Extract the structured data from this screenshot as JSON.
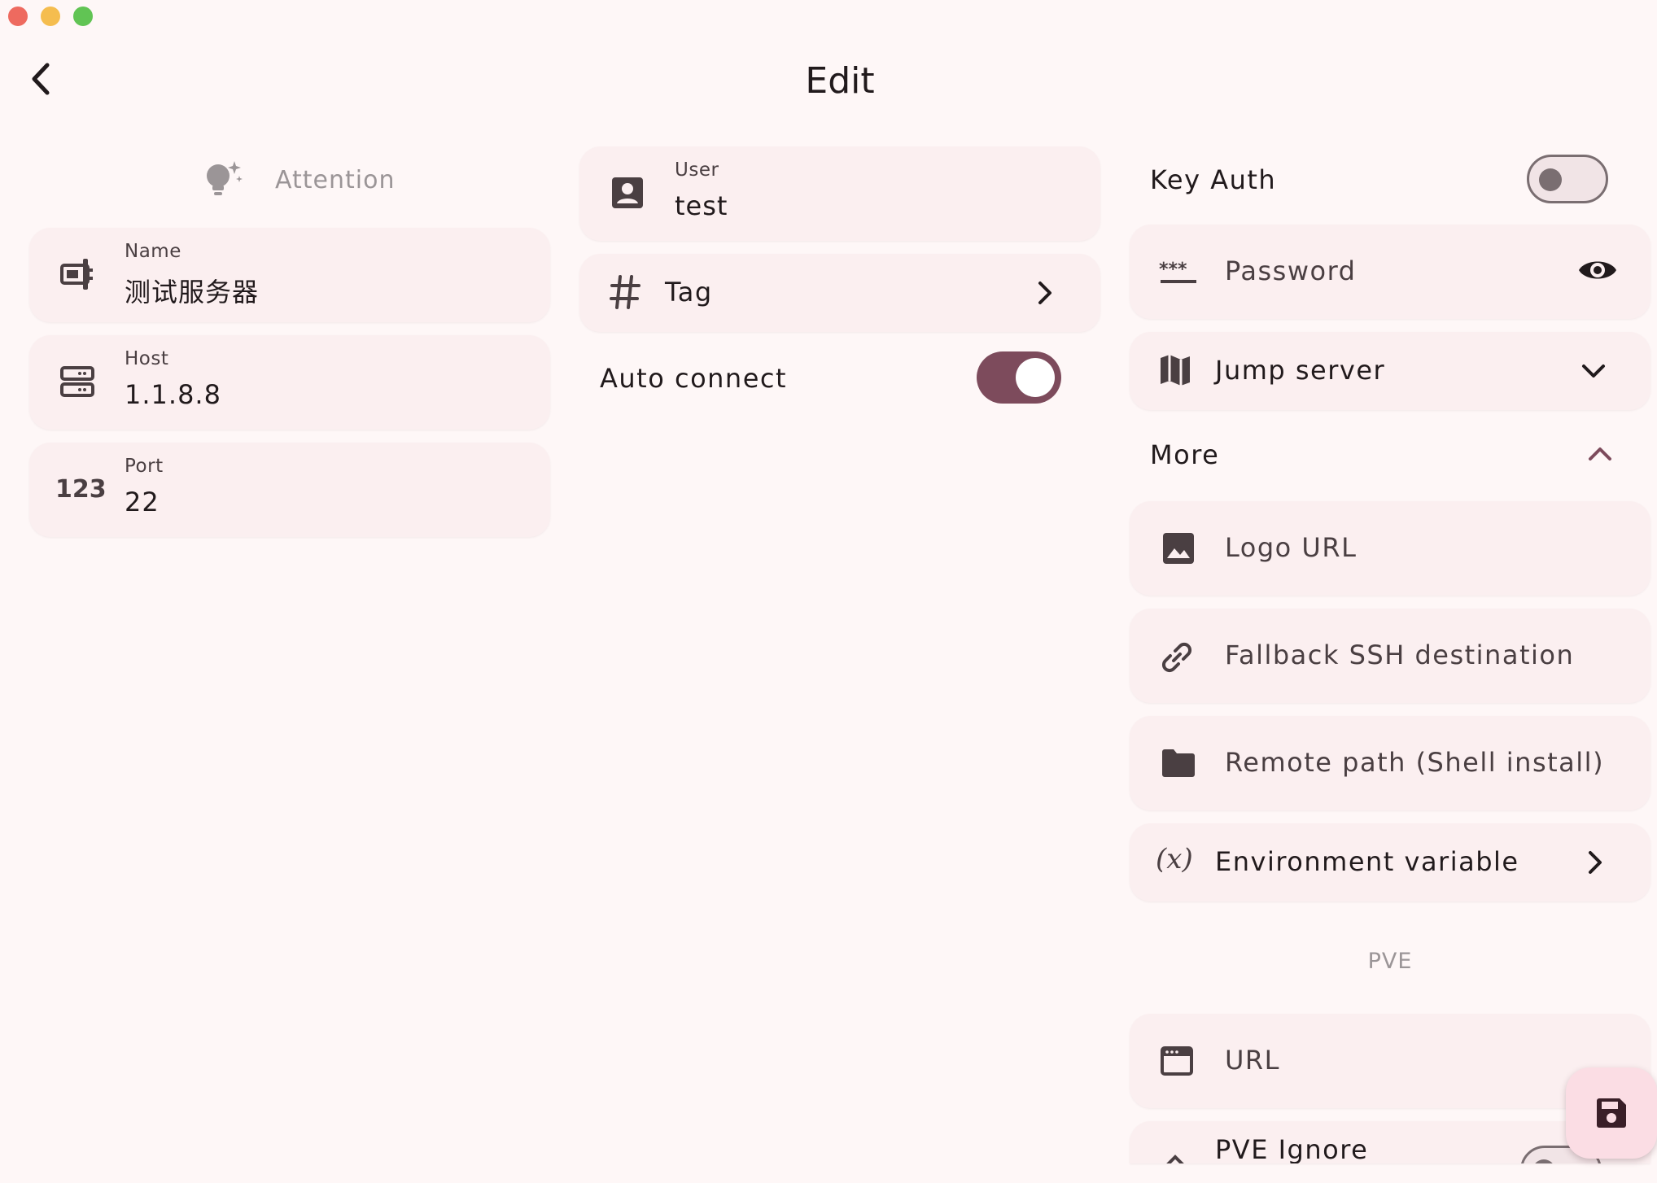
{
  "window": {
    "close_color": "#ee6a5f",
    "minimize_color": "#f5bd4f",
    "zoom_color": "#61c454"
  },
  "header": {
    "title": "Edit",
    "back_icon": "chevron-left-icon"
  },
  "colors": {
    "accent": "#7d4b5c",
    "card_bg": "#fbeff0",
    "page_bg": "#fef7f7",
    "muted": "#9b9597",
    "fab_bg": "#fbdde4"
  },
  "left": {
    "attention": {
      "label": "Attention",
      "icon": "lightbulb-sparkle-icon"
    },
    "name": {
      "label": "Name",
      "value": "测试服务器",
      "icon": "badge-icon"
    },
    "host": {
      "label": "Host",
      "value": "1.1.8.8",
      "icon": "server-icon"
    },
    "port": {
      "label": "Port",
      "value": "22",
      "icon_text": "123"
    }
  },
  "middle": {
    "user": {
      "label": "User",
      "value": "test",
      "icon": "account-box-icon"
    },
    "tag": {
      "label": "Tag",
      "icon": "hash-icon"
    },
    "auto_connect": {
      "label": "Auto connect",
      "on": true
    }
  },
  "right": {
    "key_auth": {
      "label": "Key Auth",
      "on": false
    },
    "password": {
      "placeholder": "Password",
      "icon": "password-icon",
      "visibility_icon": "eye-icon"
    },
    "jump_server": {
      "label": "Jump server",
      "icon": "map-icon"
    },
    "more": {
      "label": "More",
      "expanded": true
    },
    "logo_url": {
      "label": "Logo URL",
      "icon": "image-icon"
    },
    "fallback": {
      "label": "Fallback SSH destination",
      "icon": "link-icon"
    },
    "remote_path": {
      "label": "Remote path (Shell install)",
      "icon": "folder-icon"
    },
    "env": {
      "label": "Environment variable",
      "icon": "function-variable-icon",
      "icon_text": "(x)"
    },
    "pve_section": "PVE",
    "url": {
      "label": "URL",
      "icon": "web-window-icon"
    },
    "pve_ignore": {
      "label": "PVE Ignore"
    }
  },
  "fab": {
    "icon": "save-icon"
  }
}
